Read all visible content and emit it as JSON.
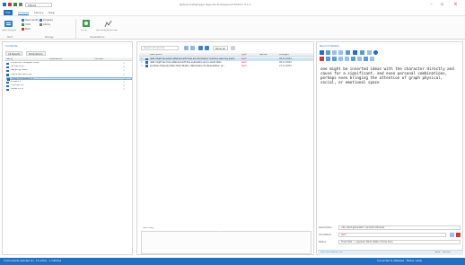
{
  "window": {
    "title": "ReferenceManager Reports Professional Edition 0.1.1"
  },
  "ribbon": {
    "file_tab": "File",
    "tabs": [
      "Analysis",
      "Library",
      "Help"
    ],
    "import_label": "Import",
    "big_buttons": [
      "Start analysis",
      "Comic",
      "List Analysis Scores"
    ],
    "small_buttons": [
      "Save results",
      "Undo",
      "Redo",
      "Compare",
      "Library"
    ],
    "groups": [
      "Start",
      "Manage",
      "Visualizations"
    ]
  },
  "left_panel": {
    "title": "Contents",
    "tabs": [
      "All Results",
      "Publications"
    ],
    "columns": [
      "Name",
      "Publications",
      "File Size"
    ],
    "items": [
      {
        "name": "Collection Analysis Tools",
        "selected": false
      },
      {
        "name": "All Records",
        "selected": false
      },
      {
        "name": "Recently Used",
        "selected": false
      },
      {
        "name": "Imported Records",
        "selected": false
      },
      {
        "name": "Copy Annotation 1",
        "selected": true
      },
      {
        "name": "Project 1",
        "selected": false
      },
      {
        "name": "Untitled 28",
        "selected": false
      },
      {
        "name": "OCAPT-2.0",
        "selected": false
      }
    ]
  },
  "middle_panel": {
    "search_placeholder": "Search all records",
    "filter_label": "Show all",
    "columns": [
      "Description",
      "Type",
      "Review",
      "Changed"
    ],
    "rows": [
      {
        "num": "1",
        "description": "data might be easier attained with free ed information machine learning query",
        "type": "alert",
        "date": "09.01.2024"
      },
      {
        "num": "2",
        "description": "data might be more attained with the evaluation and a small tests",
        "type": "alert",
        "date": "09.01.2024"
      },
      {
        "num": "3",
        "description": "Jonathan Edwards (Bell 2012) Matrix, Wikimedia of Interpretation (C…",
        "type": "alert",
        "date": "27.01.2024"
      }
    ],
    "bottom_label": "Summary"
  },
  "right_panel": {
    "title": "Record Details",
    "text": "one might be inserted ideas with the character directly and cause for a significant, and even personal combinations, perhaps even bringing the attention of graph physical, social, or emotional space",
    "fields": [
      {
        "label": "Description",
        "value": "rule, (text generation / prompt retrieval)"
      },
      {
        "label": "Annotation",
        "value": "alert"
      },
      {
        "label": "Status",
        "value": "Final mark — required, 09.01.2024 or time done"
      }
    ],
    "bottom_bar_left": "Add Annotation (0)",
    "bottom_bar_right": "Save · Cancel"
  },
  "status_bar": {
    "left": "4 Documents selected (1) · 14 Active · 1 matches",
    "right": "Connected to database · Status: ready"
  },
  "colors": {
    "accent": "#1e6fc7",
    "selection": "#cfe3f7",
    "alert": "#d0342c",
    "check": "#2b9a3a"
  }
}
